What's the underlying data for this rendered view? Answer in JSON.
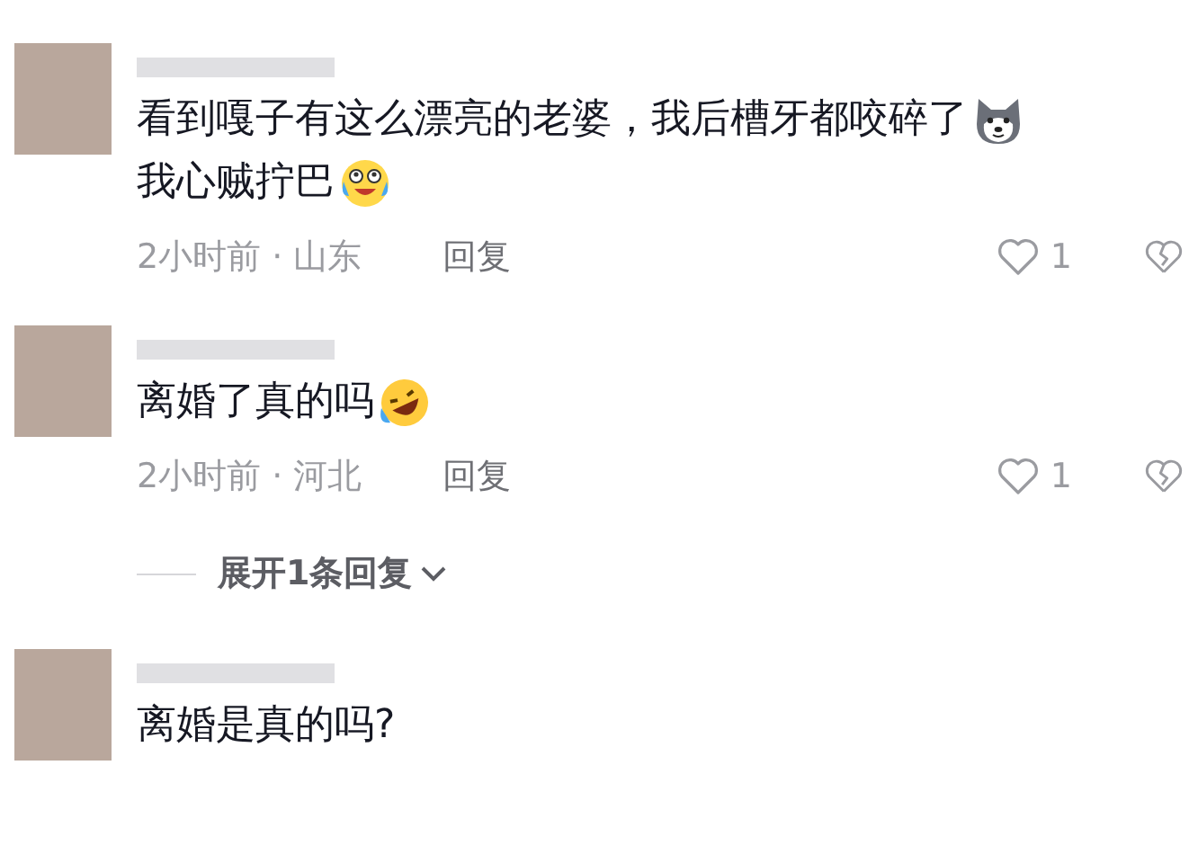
{
  "comments": [
    {
      "lines": [
        {
          "text": "看到嘎子有这么漂亮的老婆，我后槽牙都咬碎了",
          "emoji": {
            "kind": "dog"
          }
        },
        {
          "text": "我心贼拧巴",
          "emoji": {
            "kind": "cry-laugh"
          }
        }
      ],
      "meta": "2小时前 · 山东",
      "reply": "回复",
      "likes": "1"
    },
    {
      "lines": [
        {
          "text": "离婚了真的吗",
          "emoji": {
            "kind": "rofl"
          }
        }
      ],
      "meta": "2小时前 · 河北",
      "reply": "回复",
      "likes": "1",
      "expand": "展开1条回复"
    },
    {
      "lines": [
        {
          "text": "离婚是真的吗?"
        }
      ]
    }
  ]
}
